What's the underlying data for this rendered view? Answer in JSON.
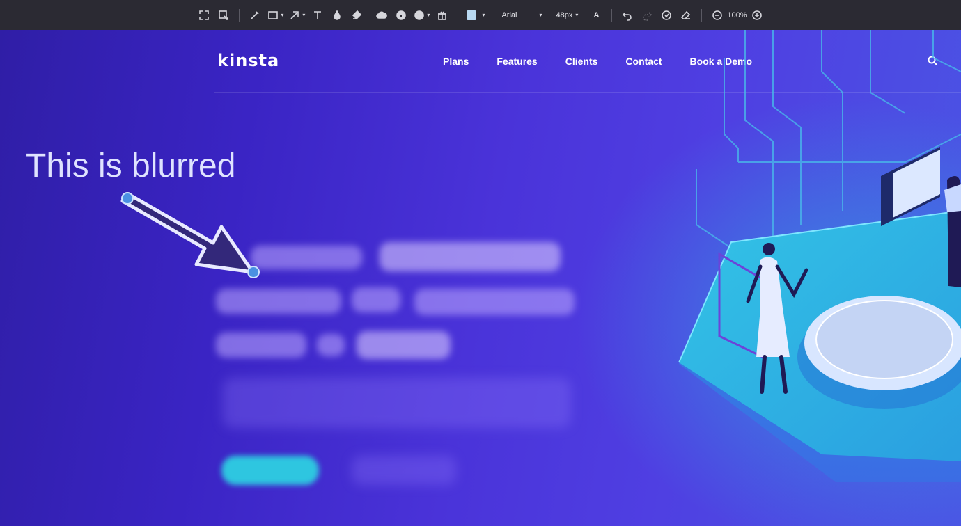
{
  "toolbar": {
    "tools": [
      {
        "icon": "fullscreen-icon"
      },
      {
        "icon": "crop-select-icon"
      },
      {
        "icon": "pen-icon"
      },
      {
        "icon": "rectangle-icon",
        "dropdown": true
      },
      {
        "icon": "arrow-icon",
        "dropdown": true
      },
      {
        "icon": "text-icon"
      },
      {
        "icon": "blur-drop-icon"
      },
      {
        "icon": "highlighter-icon"
      },
      {
        "icon": "sticker-cloud-icon"
      },
      {
        "icon": "sticker-info-icon"
      },
      {
        "icon": "sticker-emoji-icon",
        "dropdown": true
      },
      {
        "icon": "sticker-gift-icon"
      }
    ],
    "color_swatch": "#b9d9f2",
    "font_name": "Arial",
    "font_size": "48px",
    "text_style_label": "A",
    "zoom": "100%"
  },
  "nav": {
    "logo": "kinsta",
    "links": [
      "Plans",
      "Features",
      "Clients",
      "Contact",
      "Book a Demo"
    ]
  },
  "annotation": {
    "text": "This is blurred",
    "text_color": "#dfe3ff",
    "arrow_fill": "#33287a",
    "arrow_stroke": "#e8eaff",
    "handle_color": "#4a90e2"
  },
  "colors": {
    "hero_start": "#2f1ea6",
    "hero_end": "#4a56e4",
    "cta": "#2ec6e0",
    "toolbar_bg": "#2b2a33"
  }
}
